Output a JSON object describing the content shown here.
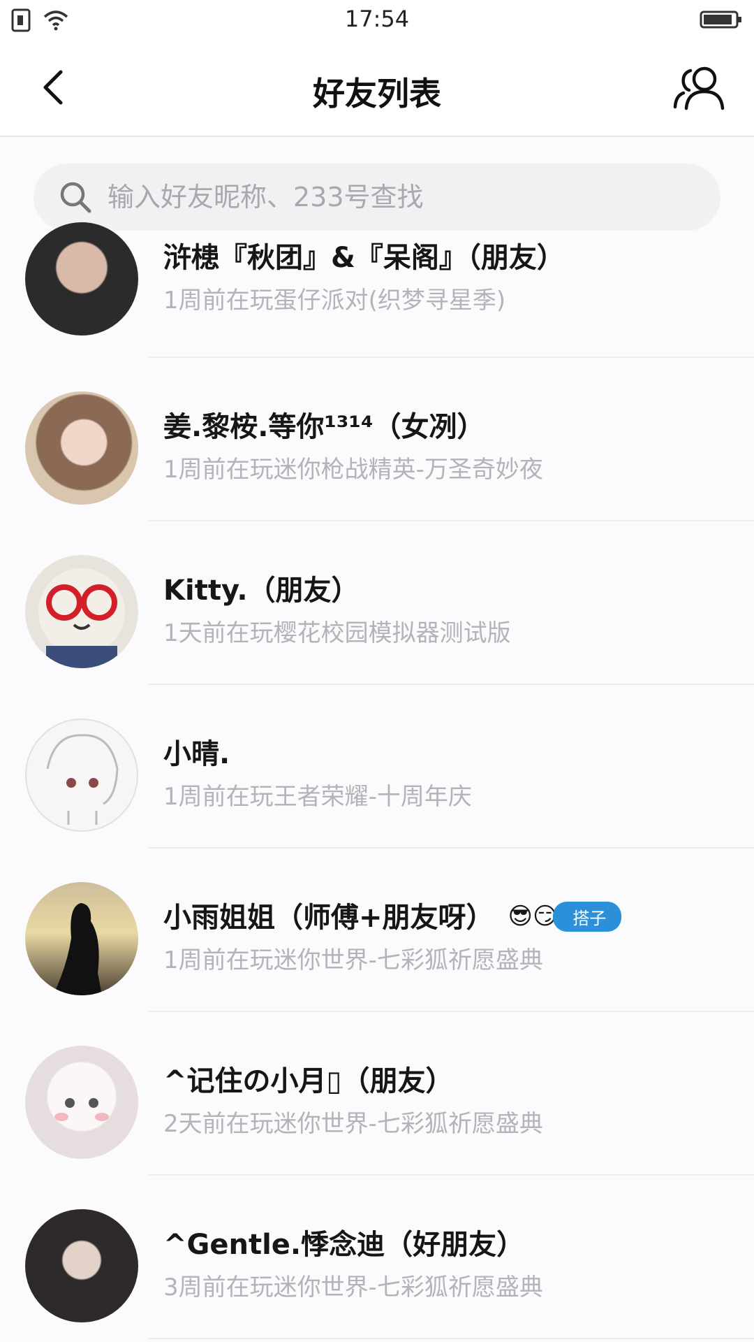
{
  "statusbar": {
    "time": "17:54"
  },
  "header": {
    "title": "好友列表"
  },
  "search": {
    "placeholder": "输入好友昵称、233号查找"
  },
  "friends": [
    {
      "name": "浒槵『秋团』&『呆阁』（朋友）",
      "status": "1周前在玩蛋仔派对(织梦寻星季)",
      "avatar_color": "#2b2b2b"
    },
    {
      "name": "姜.黎桉.等你¹³¹⁴（女冽）",
      "status": "1周前在玩迷你枪战精英-万圣奇妙夜",
      "avatar_color": "#c9b29a"
    },
    {
      "name": "Kitty.（朋友）",
      "status": "1天前在玩樱花校园模拟器测试版",
      "avatar_color": "#e6e1da"
    },
    {
      "name": "小晴.",
      "status": "1周前在玩王者荣耀-十周年庆",
      "avatar_color": "#f4f2f2"
    },
    {
      "name": "小雨姐姐（师傅+朋友呀）",
      "status": "1周前在玩迷你世界-七彩狐祈愿盛典",
      "avatar_color": "#6b5b3a",
      "badge": {
        "emoji": "😎😏",
        "label": "搭子"
      }
    },
    {
      "name": "^记住の小月▯（朋友）",
      "status": "2天前在玩迷你世界-七彩狐祈愿盛典",
      "avatar_color": "#efe9ea"
    },
    {
      "name": "^Gentle.悸念迪（好朋友）",
      "status": "3周前在玩迷你世界-七彩狐祈愿盛典",
      "avatar_color": "#2e2a2c"
    }
  ]
}
